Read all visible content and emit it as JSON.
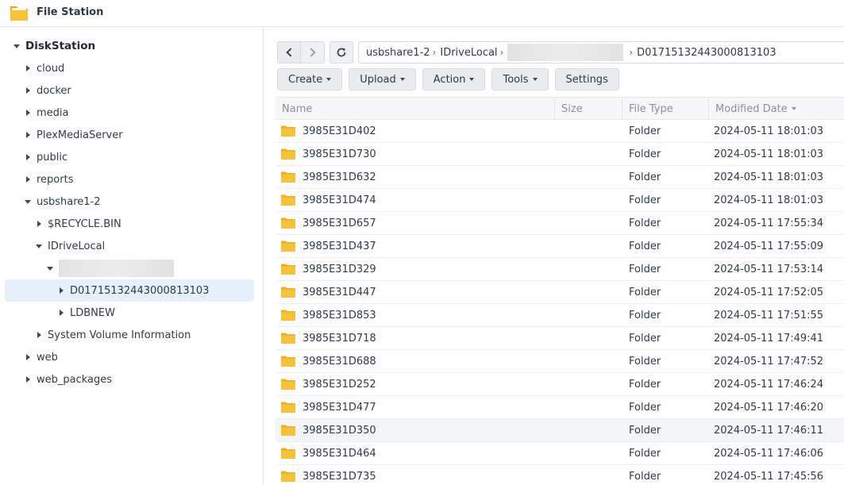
{
  "app": {
    "title": "File Station",
    "colors": {
      "folder": "#f7c23b",
      "folder_tab": "#f0ad24",
      "selected_bg": "#e6f0fb"
    }
  },
  "sidebar": {
    "root": "DiskStation",
    "items": [
      {
        "label": "cloud"
      },
      {
        "label": "docker"
      },
      {
        "label": "media"
      },
      {
        "label": "PlexMediaServer"
      },
      {
        "label": "public"
      },
      {
        "label": "reports"
      },
      {
        "label": "usbshare1-2"
      },
      {
        "label": "$RECYCLE.BIN"
      },
      {
        "label": "IDriveLocal"
      },
      {
        "label": ""
      },
      {
        "label": "D01715132443000813103"
      },
      {
        "label": "LDBNEW"
      },
      {
        "label": "System Volume Information"
      },
      {
        "label": "web"
      },
      {
        "label": "web_packages"
      }
    ]
  },
  "nav": {
    "back_icon": "chevron-left-icon",
    "forward_icon": "chevron-right-icon",
    "refresh_icon": "refresh-icon",
    "path": [
      "usbshare1-2",
      "IDriveLocal",
      "",
      "D01715132443000813103"
    ]
  },
  "toolbar": {
    "create": "Create",
    "upload": "Upload",
    "action": "Action",
    "tools": "Tools",
    "settings": "Settings"
  },
  "table": {
    "columns": {
      "name": "Name",
      "size": "Size",
      "type": "File Type",
      "modified": "Modified Date"
    },
    "rows": [
      {
        "name": "3985E31D402",
        "size": "",
        "type": "Folder",
        "modified": "2024-05-11 18:01:03"
      },
      {
        "name": "3985E31D730",
        "size": "",
        "type": "Folder",
        "modified": "2024-05-11 18:01:03"
      },
      {
        "name": "3985E31D632",
        "size": "",
        "type": "Folder",
        "modified": "2024-05-11 18:01:03"
      },
      {
        "name": "3985E31D474",
        "size": "",
        "type": "Folder",
        "modified": "2024-05-11 18:01:03"
      },
      {
        "name": "3985E31D657",
        "size": "",
        "type": "Folder",
        "modified": "2024-05-11 17:55:34"
      },
      {
        "name": "3985E31D437",
        "size": "",
        "type": "Folder",
        "modified": "2024-05-11 17:55:09"
      },
      {
        "name": "3985E31D329",
        "size": "",
        "type": "Folder",
        "modified": "2024-05-11 17:53:14"
      },
      {
        "name": "3985E31D447",
        "size": "",
        "type": "Folder",
        "modified": "2024-05-11 17:52:05"
      },
      {
        "name": "3985E31D853",
        "size": "",
        "type": "Folder",
        "modified": "2024-05-11 17:51:55"
      },
      {
        "name": "3985E31D718",
        "size": "",
        "type": "Folder",
        "modified": "2024-05-11 17:49:41"
      },
      {
        "name": "3985E31D688",
        "size": "",
        "type": "Folder",
        "modified": "2024-05-11 17:47:52"
      },
      {
        "name": "3985E31D252",
        "size": "",
        "type": "Folder",
        "modified": "2024-05-11 17:46:24"
      },
      {
        "name": "3985E31D477",
        "size": "",
        "type": "Folder",
        "modified": "2024-05-11 17:46:20"
      },
      {
        "name": "3985E31D350",
        "size": "",
        "type": "Folder",
        "modified": "2024-05-11 17:46:11"
      },
      {
        "name": "3985E31D464",
        "size": "",
        "type": "Folder",
        "modified": "2024-05-11 17:46:06"
      },
      {
        "name": "3985E31D735",
        "size": "",
        "type": "Folder",
        "modified": "2024-05-11 17:45:56"
      }
    ]
  }
}
